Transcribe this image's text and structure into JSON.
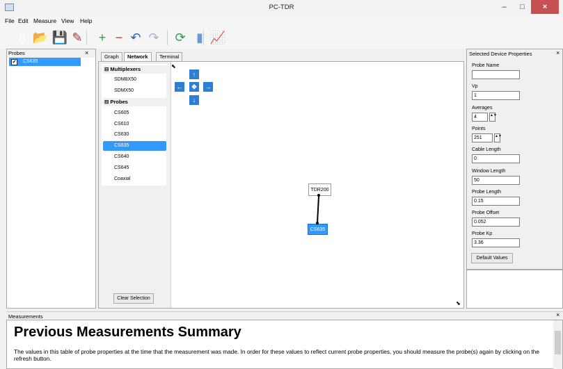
{
  "window": {
    "title": "PC-TDR",
    "min": "–",
    "max": "□",
    "close": "×"
  },
  "menu": [
    "File",
    "Edit",
    "Measure",
    "View",
    "Help"
  ],
  "toolbar": [
    {
      "name": "new-file-icon",
      "glyph": "▯",
      "color": "#ffffff"
    },
    {
      "name": "open-folder-icon",
      "glyph": "📂",
      "color": "#e6a700"
    },
    {
      "name": "save-icon",
      "glyph": "💾",
      "color": "#2b62b5"
    },
    {
      "name": "probe-tool-icon",
      "glyph": "✎",
      "color": "#b03030"
    },
    {
      "name": "add-icon",
      "glyph": "+",
      "color": "#2aa24a"
    },
    {
      "name": "remove-icon",
      "glyph": "−",
      "color": "#d52b2b"
    },
    {
      "name": "undo-icon",
      "glyph": "↶",
      "color": "#2b62b5"
    },
    {
      "name": "redo-icon",
      "glyph": "↷",
      "color": "#9db5d8"
    },
    {
      "name": "refresh-icon",
      "glyph": "⟳",
      "color": "#2aa24a"
    },
    {
      "name": "battery-icon",
      "glyph": "▮",
      "color": "#6b9bd1"
    },
    {
      "name": "graph-icon",
      "glyph": "📈",
      "color": "#3a6fbf"
    }
  ],
  "probes_panel": {
    "title": "Probes",
    "close": "×",
    "checked": "✔",
    "selected_probe": "CS635"
  },
  "tabs": [
    "Graph",
    "Network",
    "Terminal"
  ],
  "tree": {
    "group1": "⊟ Multiplexers",
    "multiplexers": [
      "SDM8X50",
      "SDMX50"
    ],
    "group2": "⊟ Probes",
    "probes": [
      "CS605",
      "CS610",
      "CS630",
      "CS635",
      "CS640",
      "CS645",
      "Coaxial"
    ],
    "selected": "CS635"
  },
  "clear_selection": "Clear Selection",
  "network": {
    "arrows": [
      "↑",
      "←",
      "✥",
      "→",
      "↓"
    ],
    "device": "TDR200",
    "probe": "CS635",
    "resize": "⬉"
  },
  "properties": {
    "title": "Selected Device Properties",
    "close": "×",
    "fields": [
      {
        "label": "Probe Name",
        "value": ""
      },
      {
        "label": "Vp",
        "value": "1"
      },
      {
        "label": "Averages",
        "value": "4"
      },
      {
        "label": "Points",
        "value": "251"
      },
      {
        "label": "Cable Length",
        "value": "0"
      },
      {
        "label": "Window Length",
        "value": "50"
      },
      {
        "label": "Probe Length",
        "value": "0.15"
      },
      {
        "label": "Probe Offset",
        "value": "0.052"
      },
      {
        "label": "Probe Kp",
        "value": "3.36"
      }
    ],
    "spin": "▲▼",
    "default_button": "Default Values"
  },
  "measurements": {
    "title": "Measurements",
    "close": "×",
    "heading": "Previous Measurements Summary",
    "text": "The values in this table of probe properties at the time that the measurement was made. In order for these values to reflect current probe properties, you should measure the probe(s) again by clicking on the refresh button."
  }
}
